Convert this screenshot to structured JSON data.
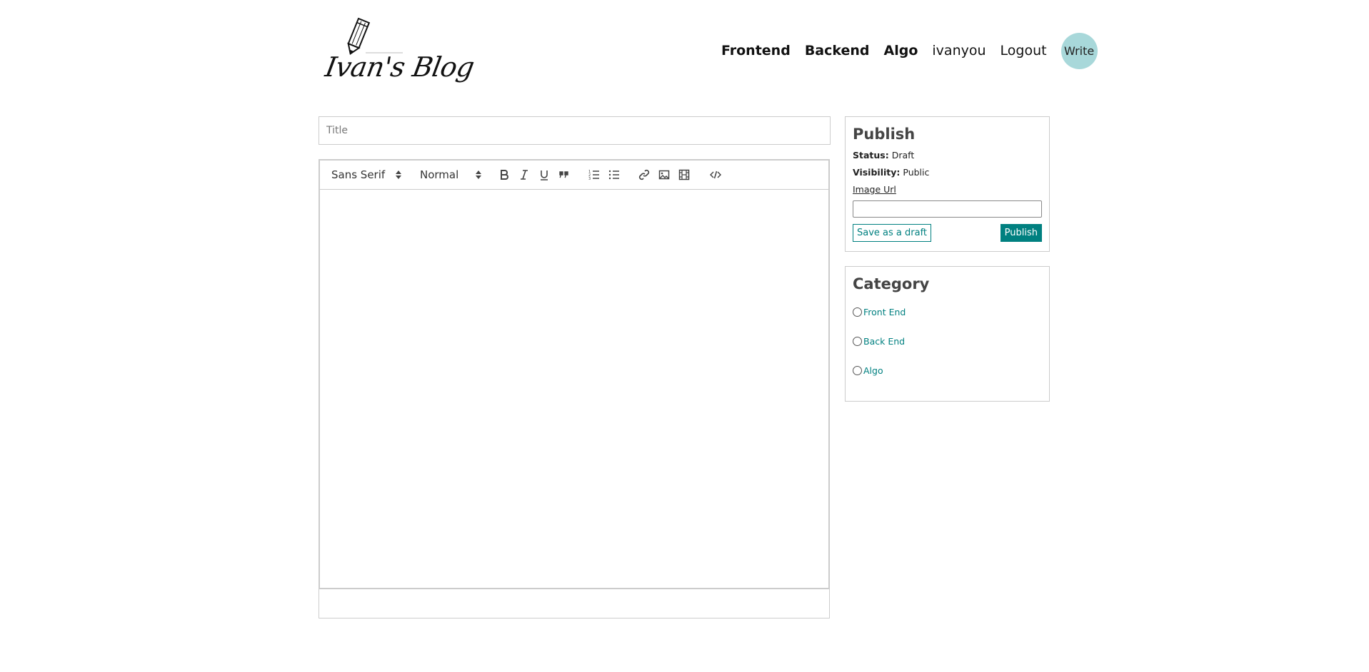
{
  "brand": {
    "name": "Ivan's Blog",
    "logo_icon": "pencil-icon"
  },
  "nav": {
    "frontend": "Frontend",
    "backend": "Backend",
    "algo": "Algo",
    "user": "ivanyou",
    "logout": "Logout",
    "write": "Write"
  },
  "editor": {
    "title_placeholder": "Title",
    "font_picker": "Sans Serif",
    "size_picker": "Normal",
    "toolbar_icons": [
      "bold-icon",
      "italic-icon",
      "underline-icon",
      "blockquote-icon",
      "ordered-list-icon",
      "bullet-list-icon",
      "link-icon",
      "image-icon",
      "video-icon",
      "code-block-icon"
    ]
  },
  "publish": {
    "heading": "Publish",
    "status_label": "Status:",
    "status_value": "Draft",
    "visibility_label": "Visibility:",
    "visibility_value": "Public",
    "image_url_label": "Image Url",
    "image_url_value": "",
    "save_draft_label": "Save as a draft",
    "publish_label": "Publish"
  },
  "category": {
    "heading": "Category",
    "options": [
      "Front End",
      "Back End",
      "Algo"
    ]
  },
  "colors": {
    "accent": "#008080",
    "write_bg": "#a8d8da",
    "border": "#cccccc"
  }
}
